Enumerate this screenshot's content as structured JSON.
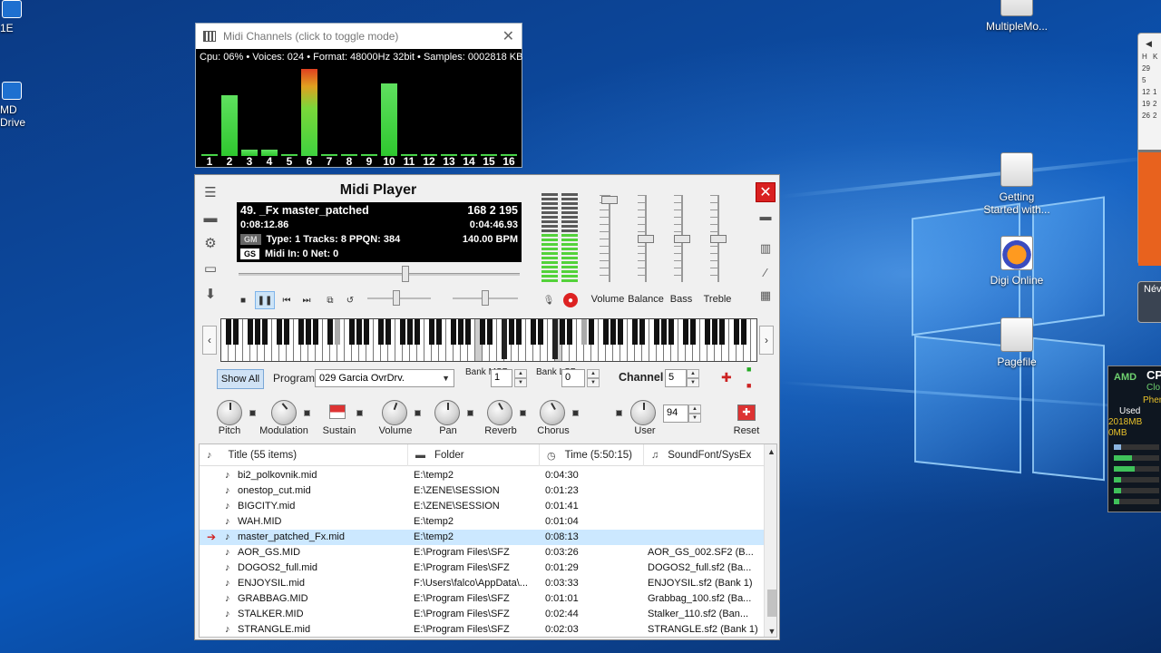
{
  "desktop": {
    "icons": [
      {
        "label_lines": [
          "1E"
        ],
        "name": "desktop-icon-1e"
      },
      {
        "label_lines": [
          "MD",
          "Drive"
        ],
        "name": "desktop-icon-drive"
      },
      {
        "label_lines": [
          "MultipleMo..."
        ],
        "name": "desktop-icon-multiplemo"
      },
      {
        "label_lines": [
          "Getting",
          "Started with..."
        ],
        "name": "desktop-icon-getting-started"
      },
      {
        "label_lines": [
          "Digi Online"
        ],
        "name": "desktop-icon-digi-online"
      },
      {
        "label_lines": [
          "Pagefile"
        ],
        "name": "desktop-icon-pagefile"
      }
    ],
    "calendar_fragment": {
      "rows": [
        "H",
        "29",
        "5",
        "12",
        "19",
        "26"
      ],
      "cols2": [
        "K",
        "",
        "",
        "1",
        "2",
        "2"
      ]
    },
    "nev_fragment": "Név",
    "cpu_widget": {
      "brand": "AMD",
      "title": "CP",
      "line1": "Clo",
      "line2": "Phen",
      "used_label": "Used",
      "mem1": "2018MB",
      "mem2": "0MB",
      "bar_levels": [
        0.15,
        0.4,
        0.45,
        0.15,
        0.15,
        0.12
      ]
    }
  },
  "channels_window": {
    "title": "Midi Channels (click to toggle mode)",
    "stats": "Cpu: 06% • Voices: 024 • Format: 48000Hz 32bit • Samples: 0002818 KB",
    "channels": [
      {
        "num": "1",
        "level": 0.0
      },
      {
        "num": "2",
        "level": 0.68
      },
      {
        "num": "3",
        "level": 0.07
      },
      {
        "num": "4",
        "level": 0.07
      },
      {
        "num": "5",
        "level": 0.0
      },
      {
        "num": "6",
        "level": 0.98
      },
      {
        "num": "7",
        "level": 0.0
      },
      {
        "num": "8",
        "level": 0.0
      },
      {
        "num": "9",
        "level": 0.0
      },
      {
        "num": "10",
        "level": 0.82
      },
      {
        "num": "11",
        "level": 0.0
      },
      {
        "num": "12",
        "level": 0.0
      },
      {
        "num": "13",
        "level": 0.0
      },
      {
        "num": "14",
        "level": 0.0
      },
      {
        "num": "15",
        "level": 0.0
      },
      {
        "num": "16",
        "level": 0.0
      }
    ]
  },
  "player": {
    "title": "Midi Player",
    "lcd": {
      "song": "49. _Fx  master_patched",
      "nums": "168  2  195",
      "elapsed": "0:08:12.86",
      "total": "0:04:46.93",
      "gm_tag": "GM",
      "info": "Type: 1  Tracks: 8  PPQN: 384",
      "bpm": "140.00 BPM",
      "gs_tag": "GS",
      "midi_in": "Midi In: 0  Net: 0"
    },
    "seek_position": 0.58,
    "mixer_labels": {
      "volume": "Volume",
      "balance": "Balance",
      "bass": "Bass",
      "treble": "Treble"
    },
    "mixer_levels": {
      "volume": 0.05,
      "balance": 0.5,
      "bass": 0.5,
      "treble": 0.5
    },
    "vu_levels": [
      0.55,
      0.55
    ],
    "controls": {
      "show_all": "Show All",
      "program_label": "Program",
      "program_value": "029 Garcia OvrDrv.",
      "bank_msb_label": "Bank MSB",
      "bank_msb_value": "1",
      "bank_lsb_label": "Bank LSB",
      "bank_lsb_value": "0",
      "channel_label": "Channel",
      "channel_value": "5"
    },
    "knobs": {
      "pitch": "Pitch",
      "modulation": "Modulation",
      "sustain": "Sustain",
      "volume": "Volume",
      "pan": "Pan",
      "reverb": "Reverb",
      "chorus": "Chorus",
      "user": "User",
      "user_value": "94",
      "reset": "Reset"
    },
    "playlist": {
      "headers": {
        "title": "Title (55 items)",
        "folder": "Folder",
        "time": "Time (5:50:15)",
        "soundfont": "SoundFont/SysEx"
      },
      "rows": [
        {
          "title": "bi2_polkovnik.mid",
          "folder": "E:\\temp2",
          "time": "0:04:30",
          "soundfont": "",
          "current": false
        },
        {
          "title": "onestop_cut.mid",
          "folder": "E:\\ZENE\\SESSION",
          "time": "0:01:23",
          "soundfont": "",
          "current": false
        },
        {
          "title": "BIGCITY.mid",
          "folder": "E:\\ZENE\\SESSION",
          "time": "0:01:41",
          "soundfont": "",
          "current": false
        },
        {
          "title": "WAH.MID",
          "folder": "E:\\temp2",
          "time": "0:01:04",
          "soundfont": "",
          "current": false
        },
        {
          "title": "master_patched_Fx.mid",
          "folder": "E:\\temp2",
          "time": "0:08:13",
          "soundfont": "",
          "current": true
        },
        {
          "title": "AOR_GS.MID",
          "folder": "E:\\Program Files\\SFZ",
          "time": "0:03:26",
          "soundfont": "AOR_GS_002.SF2 (B...",
          "current": false
        },
        {
          "title": "DOGOS2_full.mid",
          "folder": "E:\\Program Files\\SFZ",
          "time": "0:01:29",
          "soundfont": "DOGOS2_full.sf2 (Ba...",
          "current": false
        },
        {
          "title": "ENJOYSIL.mid",
          "folder": "F:\\Users\\falco\\AppData\\...",
          "time": "0:03:33",
          "soundfont": "ENJOYSIL.sf2 (Bank 1)",
          "current": false
        },
        {
          "title": "GRABBAG.MID",
          "folder": "E:\\Program Files\\SFZ",
          "time": "0:01:01",
          "soundfont": "Grabbag_100.sf2 (Ba...",
          "current": false
        },
        {
          "title": "STALKER.MID",
          "folder": "E:\\Program Files\\SFZ",
          "time": "0:02:44",
          "soundfont": "Stalker_110.sf2 (Ban...",
          "current": false
        },
        {
          "title": "STRANGLE.mid",
          "folder": "E:\\Program Files\\SFZ",
          "time": "0:02:03",
          "soundfont": "STRANGLE.sf2 (Bank 1)",
          "current": false
        }
      ]
    }
  }
}
